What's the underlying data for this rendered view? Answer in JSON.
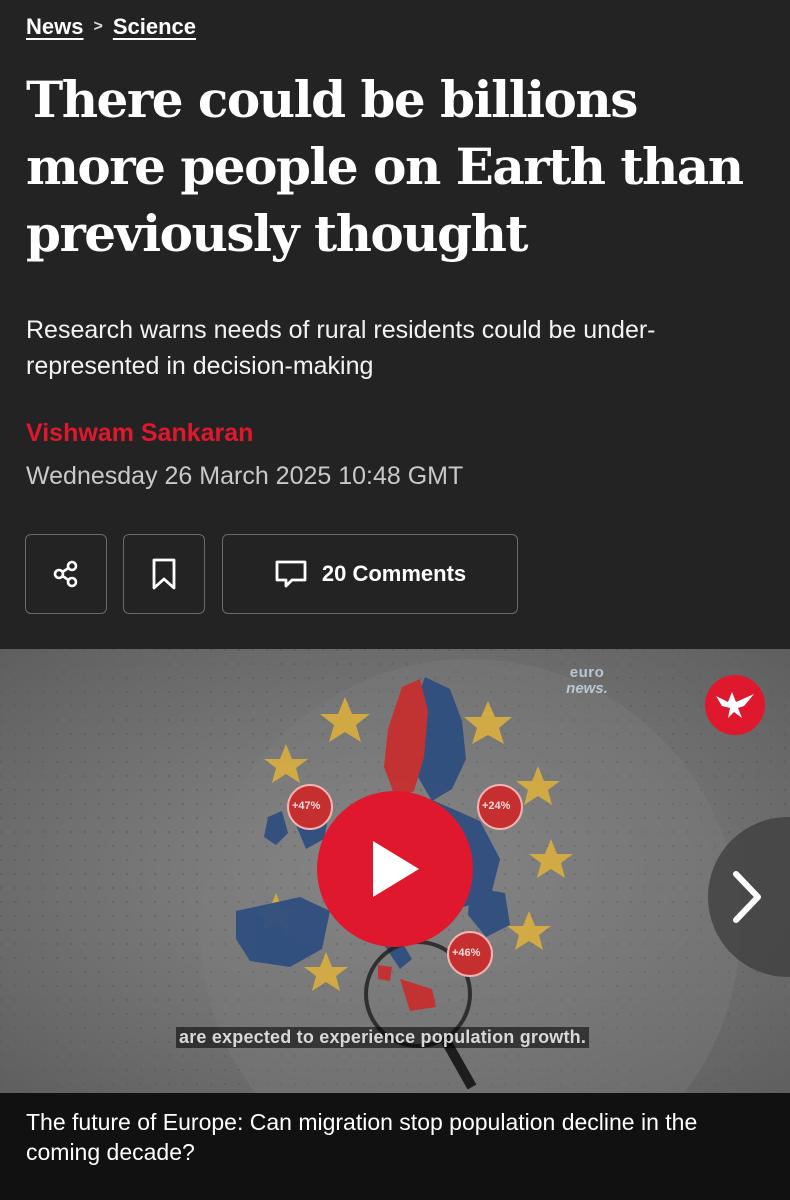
{
  "breadcrumb": {
    "section": "News",
    "subsection": "Science"
  },
  "article": {
    "title": "There could be billions more people on Earth than previously thought",
    "standfirst": "Research warns needs of rural residents could be under-represented in decision-making",
    "author": "Vishwam Sankaran",
    "date": "Wednesday 26 March 2025 10:48 GMT"
  },
  "actions": {
    "share_icon": "share-icon",
    "bookmark_icon": "bookmark-icon",
    "comments_icon": "comment-icon",
    "comments_label": "20 Comments"
  },
  "video": {
    "watermark_line1": "euro",
    "watermark_line2": "news.",
    "badges": [
      "+47%",
      "+24%",
      "+46%"
    ],
    "subtitle": "are expected to experience population growth.",
    "caption": "The future of Europe: Can migration stop population decline in the coming decade?",
    "play_icon": "play-icon",
    "next_icon": "chevron-right-icon",
    "logo_icon": "eagle-logo-icon"
  },
  "colors": {
    "background": "#232323",
    "accent": "#e0182d",
    "map_blue": "#2f4e7f",
    "map_red": "#c62f2f",
    "star_yellow": "#e0b23c"
  }
}
